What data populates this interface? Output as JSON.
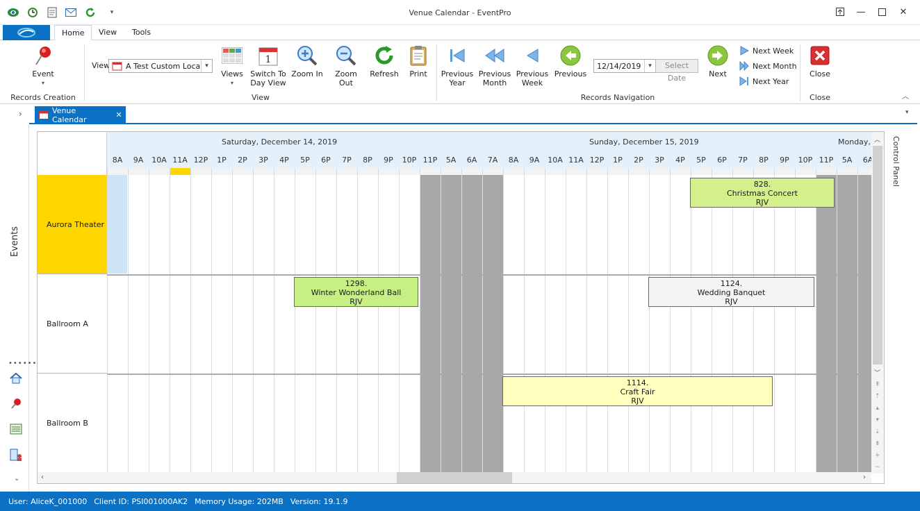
{
  "app_title": "Venue Calendar - EventPro",
  "menu": {
    "tabs": [
      "Home",
      "View",
      "Tools"
    ]
  },
  "ribbon": {
    "event_label": "Event",
    "records_creation_label": "Records Creation",
    "view_label": "View",
    "view_select_value": "A Test Custom Loca…",
    "views_label": "Views",
    "switch_day_label": [
      "Switch To",
      "Day View"
    ],
    "zoom_in_label": "Zoom In",
    "zoom_out_label": "Zoom Out",
    "refresh_label": "Refresh",
    "print_label": "Print",
    "view_group_label": "View",
    "prev_year_label": [
      "Previous",
      "Year"
    ],
    "prev_month_label": [
      "Previous",
      "Month"
    ],
    "prev_week_label": [
      "Previous",
      "Week"
    ],
    "previous_label": "Previous",
    "date_value": "12/14/2019",
    "select_date_label": "Select Date",
    "next_label": "Next",
    "next_week_label": "Next Week",
    "next_month_label": "Next Month",
    "next_year_label": "Next Year",
    "records_nav_label": "Records Navigation",
    "close_label": "Close",
    "close_group_label": "Close"
  },
  "doc_tab": {
    "label": "Venue Calendar"
  },
  "side": {
    "events_label": "Events",
    "control_panel_label": "Control Panel"
  },
  "calendar": {
    "days": [
      "Saturday, December 14, 2019",
      "Sunday, December 15, 2019",
      "Monday,…"
    ],
    "hours": [
      "8A",
      "9A",
      "10A",
      "11A",
      "12P",
      "1P",
      "2P",
      "3P",
      "4P",
      "5P",
      "6P",
      "7P",
      "8P",
      "9P",
      "10P",
      "11P",
      "5A",
      "6A",
      "7A",
      "8A",
      "9A",
      "10A",
      "11A",
      "12P",
      "1P",
      "2P",
      "3P",
      "4P",
      "5P",
      "6P",
      "7P",
      "8P",
      "9P",
      "10P",
      "11P",
      "5A",
      "6A"
    ],
    "resources": [
      "Aurora Theater",
      "Ballroom A",
      "Ballroom B"
    ],
    "events": [
      {
        "id": "828.",
        "name": "Christmas Concert",
        "code": "RJV",
        "color": "#d4f08c"
      },
      {
        "id": "1298.",
        "name": "Winter Wonderland Ball",
        "code": "RJV",
        "color": "#c6ef84"
      },
      {
        "id": "1124.",
        "name": "Wedding Banquet",
        "code": "RJV",
        "color": "#f4f4f4"
      },
      {
        "id": "1114.",
        "name": "Craft Fair",
        "code": "RJV",
        "color": "#ffffbe"
      }
    ]
  },
  "status": {
    "user": "User: AliceK_001000",
    "client": "Client ID: PSI001000AK2",
    "memory": "Memory Usage: 202MB",
    "version": "Version: 19.1.9"
  },
  "colors": {
    "accent": "#0b71c5",
    "resource_highlight": "#ffd700",
    "offhours": "#a8a8a8"
  }
}
